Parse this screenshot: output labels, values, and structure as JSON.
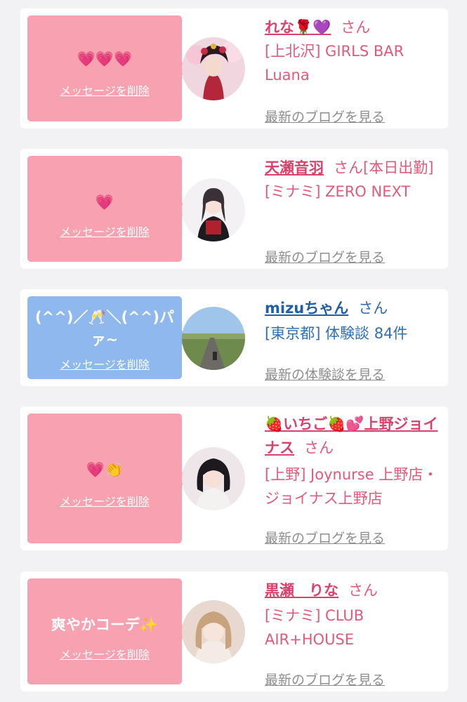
{
  "cards": [
    {
      "message": "💗💗💗",
      "delete_label": "メッセージを削除",
      "name": "れな🌹💜",
      "san": "さん",
      "shop": "[上北沢] GIRLS BAR Luana",
      "link": "最新のブログを見る",
      "avatar_icon": "avatar-photo-icon"
    },
    {
      "message": "💗",
      "delete_label": "メッセージを削除",
      "name": "天瀬音羽",
      "san": "さん[本日出勤]",
      "shop": "[ミナミ] ZERO NEXT",
      "link": "最新のブログを見る",
      "avatar_icon": "avatar-photo-icon"
    },
    {
      "message": "(^^)／🥂＼(^^)パァ~",
      "delete_label": "メッセージを削除",
      "name": "mizuちゃん",
      "san": "さん",
      "shop": "[東京都] 体験談 84件",
      "link": "最新の体験談を見る",
      "avatar_icon": "avatar-landscape-icon"
    },
    {
      "message": "💗👏",
      "delete_label": "メッセージを削除",
      "name": "🍓いちご🍓💕上野ジョイナス",
      "san": "さん",
      "shop": "[上野] Joynurse 上野店・ジョイナス上野店",
      "link": "最新のブログを見る",
      "avatar_icon": "avatar-photo-icon"
    },
    {
      "message": "爽やかコーデ✨",
      "delete_label": "メッセージを削除",
      "name": "黒瀬　りな",
      "san": "さん",
      "shop": "[ミナミ] CLUB AIR+HOUSE",
      "link": "最新のブログを見る",
      "avatar_icon": "avatar-photo-icon"
    }
  ],
  "colors": {
    "pink_bubble": "#f7a1b1",
    "blue_bubble": "#8fb8ef",
    "pink_text": "#e05b7a",
    "blue_text": "#2f6fb3",
    "link_gray": "#8e8e8e"
  }
}
